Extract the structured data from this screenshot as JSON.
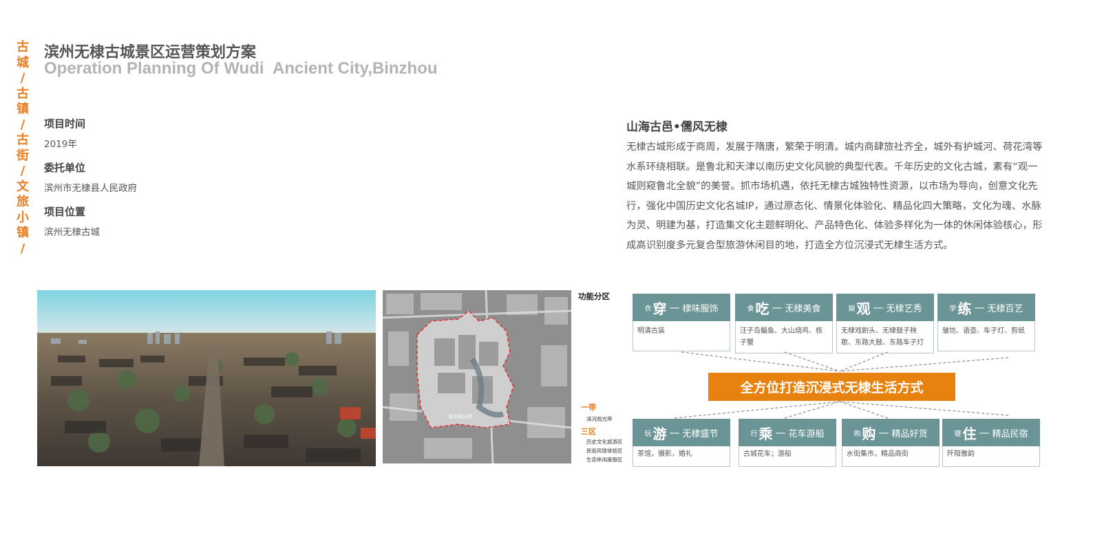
{
  "sidebar": {
    "chars": [
      "古",
      "城",
      "/",
      "古",
      "镇",
      "/",
      "古",
      "街",
      "/",
      "文",
      "旅",
      "小",
      "镇",
      "/"
    ]
  },
  "header": {
    "title_cn": "滨州无棣古城景区运营策划方案",
    "title_en": "Operation Planning Of Wudi  Ancient City,Binzhou"
  },
  "project": {
    "time_label": "项目时间",
    "time_value": "2019年",
    "client_label": "委托单位",
    "client_value": "滨州市无棣县人民政府",
    "location_label": "项目位置",
    "location_value": "滨州无棣古城"
  },
  "description": {
    "title": "山海古邑•儒风无棣",
    "body": "无棣古城形成于商周，发展于隋唐，繁荣于明清。城内商肆旅社齐全，城外有护城河、荷花湾等水系环绕相联。是鲁北和天津以南历史文化风貌的典型代表。千年历史的文化古城，素有“观一城则窥鲁北全貌”的美誉。抓市场机遇，依托无棣古城独特性资源，以市场为导向，创意文化先行，强化中国历史文化名城IP，通过原态化、情景化体验化、精品化四大策略，文化为魂、水脉为灵、明建为基，打造集文化主题鲜明化、产品特色化、体验多样化为一体的休闲体验核心，形成高识别度多元复合型旅游休闲目的地，打造全方位沉浸式无棣生活方式。"
  },
  "map_legend": {
    "title": "功能分区",
    "belt_head": "一带",
    "belt_items": [
      "滨河观光带"
    ],
    "zones_head": "三区",
    "zones_items": [
      "历史文化旅游区",
      "民俗风情体验区",
      "生态休闲度假区"
    ],
    "map_label_river": "滨河观光带"
  },
  "diagram": {
    "center": "全方位打造沉浸式无棣生活方式",
    "top": [
      {
        "pre": "衣",
        "big": "穿",
        "rest": "棣味服饰",
        "text": "明清古装"
      },
      {
        "pre": "食",
        "big": "吃",
        "rest": "无棣美食",
        "text": "汪子岛鲻鱼、大山烧鸡、核子蟹"
      },
      {
        "pre": "娱",
        "big": "观",
        "rest": "无棣艺秀",
        "text": "无棣戏剧头、无棣鼓子秧歌、东路大鼓、东路车子灯"
      },
      {
        "pre": "学",
        "big": "练",
        "rest": "无棣百艺",
        "text": "皱坊、语壶、车子灯、剪纸"
      }
    ],
    "bottom": [
      {
        "pre": "玩",
        "big": "游",
        "rest": "无棣盛节",
        "text": "茶馆，摄影，婚礼"
      },
      {
        "pre": "行",
        "big": "乘",
        "rest": "花车游船",
        "text": "古城花车；游船"
      },
      {
        "pre": "购",
        "big": "购",
        "rest": "精品好货",
        "text": "水街集市，精品商街"
      },
      {
        "pre": "寝",
        "big": "住",
        "rest": "精品民宿",
        "text": "阡陌雅韵"
      }
    ]
  },
  "colors": {
    "accent": "#e67e22",
    "banner": "#e8820e",
    "teal": "#6b9496",
    "boundary": "#e03030"
  }
}
